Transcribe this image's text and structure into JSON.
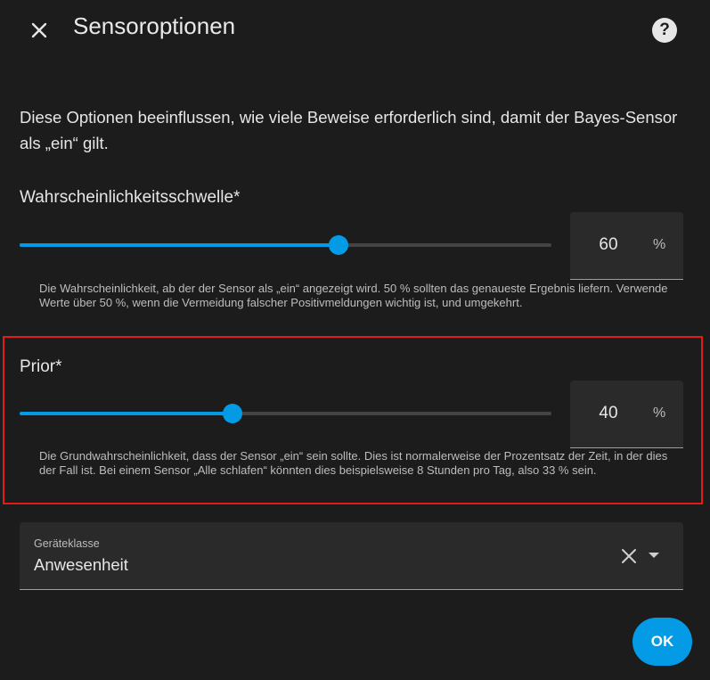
{
  "dialog": {
    "title": "Sensoroptionen",
    "help_icon": "question-mark-icon",
    "close_icon": "close-icon",
    "intro": "Diese Optionen beeinflussen, wie viele Beweise erforderlich sind, damit der Bayes-Sensor als „ein“ gilt."
  },
  "threshold": {
    "label": "Wahrscheinlichkeitsschwelle*",
    "value": "60",
    "level": 0.6,
    "unit": "%",
    "helper": "Die Wahrscheinlichkeit, ab der der Sensor als „ein“ angezeigt wird. 50 % sollten das genaueste Ergebnis liefern. Verwende Werte über 50 %, wenn die Vermeidung falscher Positivmeldungen wichtig ist, und umgekehrt."
  },
  "prior": {
    "label": "Prior*",
    "value": "40",
    "level": 0.4,
    "unit": "%",
    "helper": "Die Grundwahrscheinlichkeit, dass der Sensor „ein“ sein sollte. Dies ist normalerweise der Prozentsatz der Zeit, in der dies der Fall ist. Bei einem Sensor „Alle schlafen“ könnten dies beispielsweise 8 Stunden pro Tag, also 33 % sein."
  },
  "device_class": {
    "label": "Geräteklasse",
    "value": "Anwesenheit",
    "clear_icon": "clear-icon",
    "dropdown_icon": "dropdown-arrow-icon"
  },
  "actions": {
    "ok_label": "OK"
  },
  "colors": {
    "accent": "#039be5",
    "background": "#1c1c1c",
    "highlight_border": "#e11a1a"
  }
}
